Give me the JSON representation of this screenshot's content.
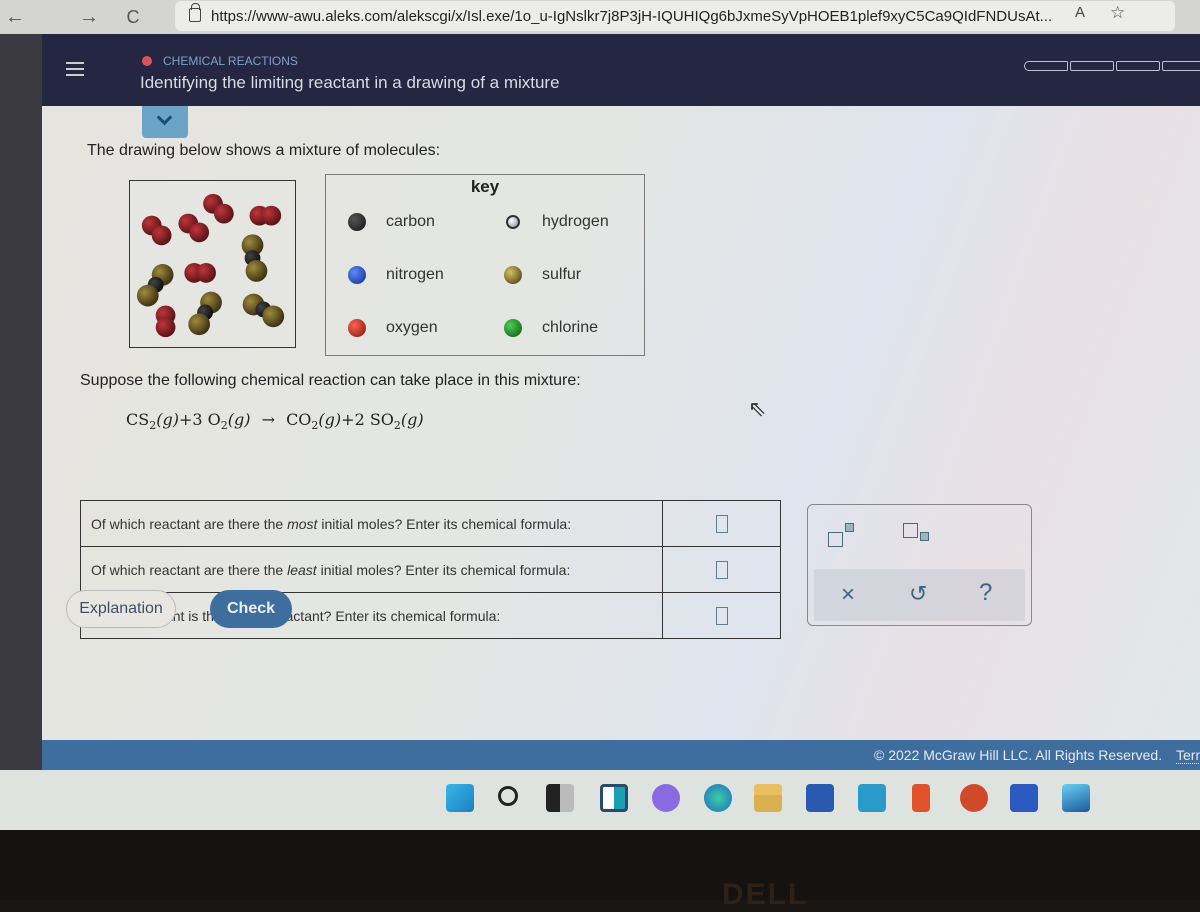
{
  "browser": {
    "url": "https://www-awu.aleks.com/alekscgi/x/Isl.exe/1o_u-IgNslkr7j8P3jH-IQUHIQg6bJxmeSyVpHOEB1plef9xyC5Ca9QIdFNDUsAt...",
    "read_aloud_label": "A",
    "nav": {
      "back": "←",
      "forward": "→",
      "refresh": "C"
    }
  },
  "header": {
    "topic": "CHEMICAL REACTIONS",
    "title": "Identifying the limiting reactant in a drawing of a mixture",
    "progress_segments": 5,
    "accent_color": "#d9535b"
  },
  "problem": {
    "intro": "The drawing below shows a mixture of molecules:",
    "mixture": {
      "molecules": [
        {
          "type": "O2",
          "count": 6
        },
        {
          "type": "CS2",
          "count": 4
        }
      ]
    },
    "key": {
      "title": "key",
      "items": [
        {
          "element": "carbon",
          "color": "#1e1e1e"
        },
        {
          "element": "hydrogen",
          "color": "#e6e8ea"
        },
        {
          "element": "nitrogen",
          "color": "#2348b8"
        },
        {
          "element": "sulfur",
          "color": "#b39628"
        },
        {
          "element": "oxygen",
          "color": "#c4302a"
        },
        {
          "element": "chlorine",
          "color": "#1a9a2a"
        }
      ]
    },
    "suppose": "Suppose the following chemical reaction can take place in this mixture:",
    "equation": {
      "reactant1": "CS",
      "reactant1_sub": "2",
      "reactant1_state": "(g)",
      "plus1": "+3 O",
      "reactant2_sub": "2",
      "reactant2_state": "(g)",
      "arrow": "→",
      "product1": "CO",
      "product1_sub": "2",
      "product1_state": "(g)",
      "plus2": "+2 SO",
      "product2_sub": "2",
      "product2_state": "(g)"
    },
    "questions": [
      {
        "pre": "Of which reactant are there the ",
        "em": "most",
        "post": " initial moles? Enter its chemical formula:",
        "answer": ""
      },
      {
        "pre": "Of which reactant are there the ",
        "em": "least",
        "post": " initial moles? Enter its chemical formula:",
        "answer": ""
      },
      {
        "pre": "Which reactant is the limiting reactant? Enter its chemical formula:",
        "em": "",
        "post": "",
        "answer": ""
      }
    ]
  },
  "tools": {
    "superscript": "superscript",
    "subscript": "subscript",
    "clear": "×",
    "undo": "↺",
    "help": "?"
  },
  "actions": {
    "explanation": "Explanation",
    "check": "Check"
  },
  "footer": {
    "copyright": "© 2022 McGraw Hill LLC. All Rights Reserved.",
    "terms": "Term"
  },
  "taskbar": {
    "apps": [
      "start",
      "search",
      "task-view",
      "widgets",
      "teams-chat",
      "edge",
      "file-explorer",
      "store",
      "mail",
      "office",
      "powerpoint",
      "word",
      "photos"
    ]
  },
  "bezel": {
    "brand": "DELL"
  }
}
